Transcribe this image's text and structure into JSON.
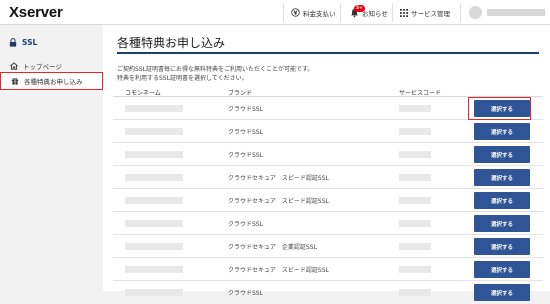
{
  "header": {
    "logo": "Xserver",
    "nav": [
      {
        "label": "料金支払い",
        "icon": "yen-circle-icon"
      },
      {
        "label": "お知らせ",
        "icon": "bell-icon",
        "badge": "5+"
      },
      {
        "label": "サービス管理",
        "icon": "grid-icon"
      }
    ]
  },
  "sidebar": {
    "title": "SSL",
    "items": [
      {
        "label": "トップページ",
        "icon": "home-icon"
      },
      {
        "label": "各種特典お申し込み",
        "icon": "gift-icon"
      }
    ]
  },
  "main": {
    "title": "各種特典お申し込み",
    "desc1": "ご契約SSL証明書毎にお得な無料特典をご利用いただくことが可能です。",
    "desc2": "特典を利用するSSL証明書を選択してください。",
    "columns": [
      "コモンネーム",
      "ブランド",
      "サービスコード"
    ],
    "rows": [
      {
        "brand": "クラウドSSL",
        "button": "選択する"
      },
      {
        "brand": "クラウドSSL",
        "button": "選択する"
      },
      {
        "brand": "クラウドSSL",
        "button": "選択する"
      },
      {
        "brand": "クラウドセキュア　スピード認証SSL",
        "button": "選択する"
      },
      {
        "brand": "クラウドセキュア　スピード認証SSL",
        "button": "選択する"
      },
      {
        "brand": "クラウドSSL",
        "button": "選択する"
      },
      {
        "brand": "クラウドセキュア　企業認証SSL",
        "button": "選択する"
      },
      {
        "brand": "クラウドセキュア　スピード認証SSL",
        "button": "選択する"
      },
      {
        "brand": "クラウドSSL",
        "button": "選択する"
      }
    ]
  },
  "colors": {
    "accent": "#2f5597",
    "navy": "#1f3c6e",
    "highlight": "#e5272d"
  }
}
